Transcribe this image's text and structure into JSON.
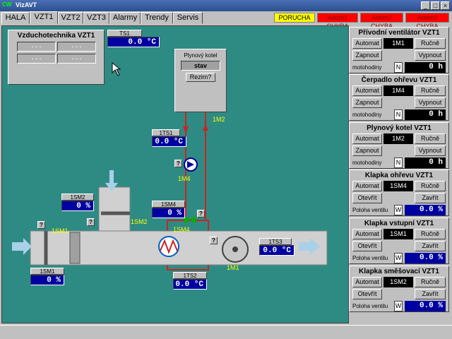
{
  "window": {
    "title": "VizAVT",
    "logo": "CW",
    "min": "_",
    "max": "□",
    "close": "×"
  },
  "tabs": [
    "HALA",
    "VZT1",
    "VZT2",
    "VZT3",
    "Alarmy",
    "Trendy",
    "Servis"
  ],
  "alarms": [
    {
      "label": "PORUCHA",
      "bg": "#ffff00",
      "color": "#000000"
    },
    {
      "label": "Adom1 CHYBA",
      "bg": "#ff0000",
      "color": "#800000"
    },
    {
      "label": "Adom2 CHYBA",
      "bg": "#ff0000",
      "color": "#800000"
    },
    {
      "label": "Adom3 CHYBA",
      "bg": "#ff0000",
      "color": "#800000"
    }
  ],
  "colors": {
    "canvas": "#2e8b84",
    "value_bg": "#0000a0",
    "pipe": "#cc2222",
    "duct": "#d0d0d0"
  },
  "info": {
    "title": "Vzduchotechnika VZT1",
    "cells": [
      "- - -",
      "- - -",
      "- - -",
      "- - -"
    ]
  },
  "ts1": {
    "label": "TS1",
    "value": "0.0 °C"
  },
  "boiler": {
    "title": "Plynový kotel",
    "state": "stav",
    "mode": "Rezim?"
  },
  "sensors": {
    "1ts1": {
      "label": "1TS1",
      "value": "0.0 °C"
    },
    "1sm2": {
      "label": "1SM2",
      "value": "0 %"
    },
    "1sm4": {
      "label": "1SM4",
      "value": "0 %"
    },
    "1ts3": {
      "label": "1TS3",
      "value": "0.0 °C"
    },
    "1sm1": {
      "label": "1SM1",
      "value": "0 %"
    },
    "1ts2": {
      "label": "1TS2",
      "value": "0.0 °C"
    }
  },
  "device_labels": {
    "m4": "1M4",
    "m2": "1M2",
    "m1": "1M1",
    "sm1": "1SM1",
    "sm2": "1SM2",
    "sm4": "1SM4"
  },
  "q": "?",
  "panels": [
    {
      "title": "Přívodní ventilátor VZT1",
      "auto": "Automat",
      "id": "1M1",
      "manual": "Ručně",
      "on": "Zapnout",
      "off": "Vypnout",
      "hours_label": "motohodiny",
      "n": "N",
      "hours": "0 h"
    },
    {
      "title": "Čerpadlo ohřevu VZT1",
      "auto": "Automat",
      "id": "1M4",
      "manual": "Ručně",
      "on": "Zapnout",
      "off": "Vypnout",
      "hours_label": "motohodiny",
      "n": "N",
      "hours": "0 h"
    },
    {
      "title": "Plynový kotel VZT1",
      "auto": "Automat",
      "id": "1M2",
      "manual": "Ručně",
      "on": "Zapnout",
      "off": "Vypnout",
      "hours_label": "motohodiny",
      "n": "N",
      "hours": "0 h"
    },
    {
      "title": "Klapka ohřevu VZT1",
      "auto": "Automat",
      "id": "1SM4",
      "manual": "Ručně",
      "on": "Otevřít",
      "off": "Zavřít",
      "pos_label": "Poloha ventilu",
      "w": "W",
      "pos": "0.0 %"
    },
    {
      "title": "Klapka vstupní VZT1",
      "auto": "Automat",
      "id": "1SM1",
      "manual": "Ručně",
      "on": "Otevřít",
      "off": "Zavřít",
      "pos_label": "Poloha ventilu",
      "w": "W",
      "pos": "0.0 %"
    },
    {
      "title": "Klapka směšovací VZT1",
      "auto": "Automat",
      "id": "1SM2",
      "manual": "Ručně",
      "on": "Otevřít",
      "off": "Zavřít",
      "pos_label": "Poloha ventilu",
      "w": "W",
      "pos": "0.0 %"
    }
  ]
}
